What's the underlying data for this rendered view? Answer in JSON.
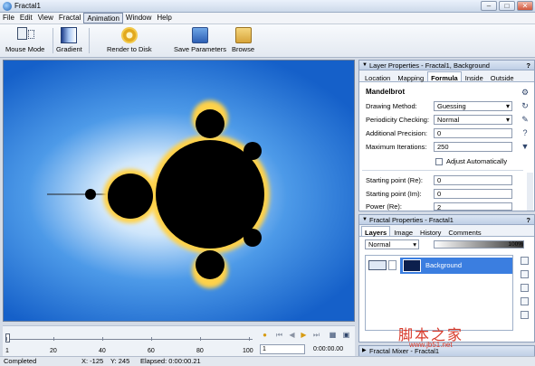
{
  "window": {
    "title": "Fractal1"
  },
  "menu": [
    "File",
    "Edit",
    "View",
    "Fractal",
    "Animation",
    "Window",
    "Help"
  ],
  "toolbar": [
    {
      "label": "Mouse Mode",
      "icon": "mouse-mode-icon"
    },
    {
      "label": "Gradient",
      "icon": "gradient-icon"
    },
    {
      "label": "Render to Disk",
      "icon": "gear-icon"
    },
    {
      "label": "Save Parameters",
      "icon": "save-parameters-icon"
    },
    {
      "label": "Browse",
      "icon": "folder-icon"
    }
  ],
  "timeline": {
    "ticks": [
      "1",
      "20",
      "40",
      "60",
      "80",
      "100"
    ],
    "frame": "1",
    "time": "0:00:00.00"
  },
  "status": {
    "state": "Completed",
    "x": "X: -125",
    "y": "Y: 245",
    "elapsed": "Elapsed: 0:00:00.21"
  },
  "layer_properties": {
    "header": "Layer Properties - Fractal1, Background",
    "tabs": [
      "Location",
      "Mapping",
      "Formula",
      "Inside",
      "Outside"
    ],
    "selected_tab": "Formula",
    "formula": "Mandelbrot",
    "rows": [
      {
        "label": "Drawing Method:",
        "value": "Guessing",
        "type": "select"
      },
      {
        "label": "Periodicity Checking:",
        "value": "Normal",
        "type": "select"
      },
      {
        "label": "Additional Precision:",
        "value": "0",
        "type": "spin"
      },
      {
        "label": "Maximum Iterations:",
        "value": "250",
        "type": "spin"
      }
    ],
    "adjust_auto": "Adjust Automatically",
    "lower_rows": [
      {
        "label": "Starting point (Re):",
        "value": "0"
      },
      {
        "label": "Starting point (Im):",
        "value": "0"
      },
      {
        "label": "Power (Re):",
        "value": "2"
      }
    ]
  },
  "fractal_properties": {
    "header": "Fractal Properties - Fractal1",
    "tabs": [
      "Layers",
      "Image",
      "History",
      "Comments"
    ],
    "selected_tab": "Layers",
    "blend_mode": "Normal",
    "opacity": "100%",
    "layer_name": "Background"
  },
  "fractal_mixer": {
    "header": "Fractal Mixer - Fractal1"
  },
  "watermark": {
    "text": "脚本之家",
    "url": "www.jb51.net"
  },
  "colors": {
    "canvas_deep": "#1560c9",
    "selection": "#3b7ee0",
    "accent": "#e9a21c"
  }
}
